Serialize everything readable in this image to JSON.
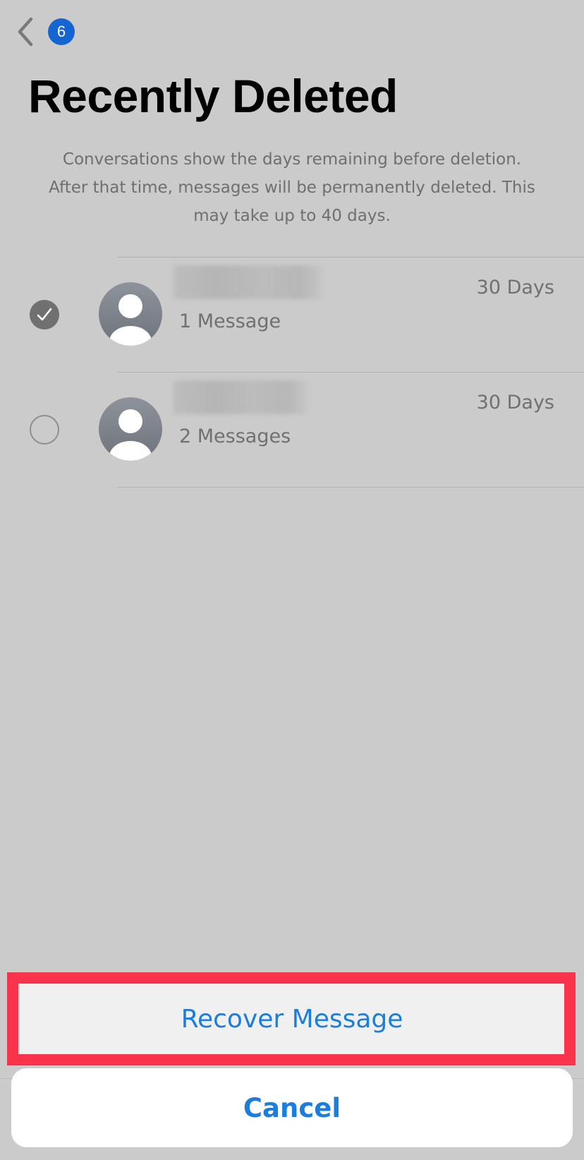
{
  "nav": {
    "back_badge": "6"
  },
  "page": {
    "title": "Recently Deleted",
    "description_lines": [
      "Conversations show the days remaining before deletion.",
      "After that time, messages will be permanently deleted. This",
      "may take up to 40 days."
    ]
  },
  "conversations": [
    {
      "selected": true,
      "count_label": "1 Message",
      "days_label": "30 Days"
    },
    {
      "selected": false,
      "count_label": "2 Messages",
      "days_label": "30 Days"
    }
  ],
  "action_sheet": {
    "recover_label": "Recover Message",
    "cancel_label": "Cancel",
    "highlight_color": "#f8334a",
    "accent_color": "#1a7ee0"
  },
  "icons": {
    "back": "chevron-left-icon",
    "selected": "checkmark-icon",
    "avatar": "person-icon"
  }
}
